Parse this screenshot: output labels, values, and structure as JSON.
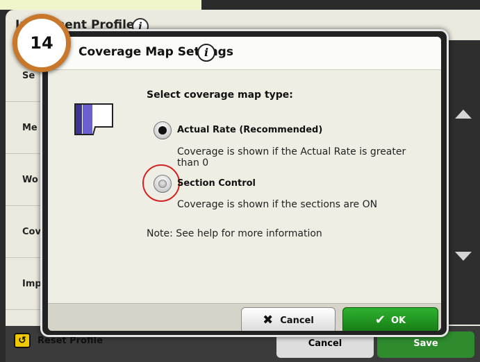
{
  "background": {
    "title": "Implement Profile",
    "list_items": [
      "Se",
      "Me",
      "Wo",
      "Cov",
      "Imp"
    ],
    "reset_label": "Reset Profile",
    "cancel_label": "Cancel",
    "save_label": "Save"
  },
  "badge": {
    "number": "14"
  },
  "dialog": {
    "title": "Coverage Map Settings",
    "prompt": "Select coverage map type:",
    "options": [
      {
        "label": "Actual Rate (Recommended)",
        "description": "Coverage is shown if the Actual Rate is greater than 0",
        "selected": true
      },
      {
        "label": "Section Control",
        "description": "Coverage is shown if the sections are ON",
        "selected": false
      }
    ],
    "note": "Note: See help for more information",
    "cancel_label": "Cancel",
    "ok_label": "OK"
  },
  "colors": {
    "ok_green": "#1f9a1f",
    "badge_orange": "#c9782b",
    "highlight_red": "#d41f1f",
    "map_fill": "#5b4fc4"
  },
  "icons": [
    "info-icon",
    "coverage-map-icon",
    "x-icon",
    "check-icon",
    "reset-icon",
    "scroll-up-icon",
    "scroll-down-icon"
  ]
}
